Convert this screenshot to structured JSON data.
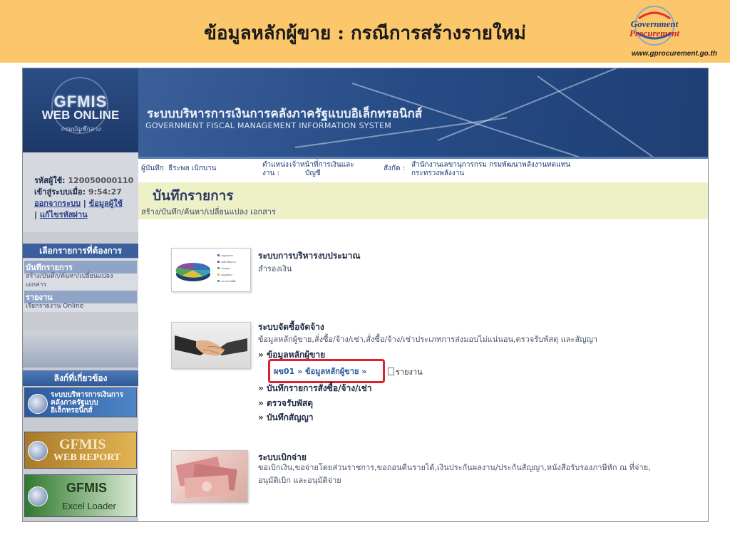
{
  "slide": {
    "title": "ข้อมูลหลักผู้ขาย : กรณีการสร้างรายใหม่",
    "logo_line1": "Government",
    "logo_line2": "Procurement",
    "url": "www.gprocurement.go.th"
  },
  "sidebar": {
    "logo": {
      "line1": "GFMIS",
      "line2": "WEB ONLINE",
      "line3": "กรมบัญชีกลาง"
    },
    "user_label": "รหัสผู้ใช้:",
    "user_id": "120050000110",
    "login_label": "เข้าสู่ระบบเมื่อ:",
    "login_time": "9:54:27",
    "logout_link": "ออกจากระบบ",
    "userinfo_link": "ข้อมูลผู้ใช้",
    "changepw_link": "แก้ไขรหัสผ่าน",
    "menu_header": "เลือกรายการที่ต้องการ",
    "menu_items": [
      {
        "title": "บันทึกรายการ",
        "sub": "สร้าง/บันทึก/ค้นหา/เปลี่ยนแปลง เอกสาร"
      },
      {
        "title": "รายงาน",
        "sub": "เรียกรายงาน Online"
      }
    ],
    "related_header": "ลิงก์ที่เกี่ยวข้อง",
    "banners": [
      {
        "label": "ระบบบริหารการเงินการคลังภาครัฐแบบอิเล็กทรอนิกส์",
        "color": "#3a6fb3"
      },
      {
        "label_line1": "GFMIS",
        "label_line2": "WEB REPORT",
        "color": "#c99a3a"
      },
      {
        "label_line1": "GFMIS",
        "label_line2": "Excel Loader",
        "color": "#3f8f3a"
      }
    ]
  },
  "banner": {
    "system_th": "ระบบบริหารการเงินการคลังภาครัฐแบบอิเล็กทรอนิกส์",
    "system_en": "GOVERNMENT FISCAL MANAGEMENT INFORMATION SYSTEM"
  },
  "info_bar": {
    "recorder_label": "ผู้บันทึก",
    "recorder_value": "ธีระพล เบิกบาน",
    "position_label_1": "ตำแหน่ง",
    "position_label_2": "งาน :",
    "position_value_1": "เจ้าหน้าที่การเงินและ",
    "position_value_2": "บัญชี",
    "dept_label": "สังกัด :",
    "dept_value_1": "สำนักงานเลขานุการกรม กรมพัฒนาพลังงานทดแทน",
    "dept_value_2": "กระทรวงพลังงาน"
  },
  "page": {
    "title": "บันทึกรายการ",
    "subtitle": "สร้าง/บันทึก/ค้นหา/เปลี่ยนแปลง เอกสาร"
  },
  "sections": {
    "budget": {
      "title": "ระบบการบริหารงบประมาณ",
      "desc": "สำรองเงิน",
      "pie": {
        "legend": [
          "งบบุคลากร",
          "งบดำเนินงาน",
          "งบลงทุน",
          "งบอุดหนุน",
          "งบรายจ่ายอื่น"
        ],
        "colors": [
          "#3d6fb5",
          "#8a4aa8",
          "#4fa85a",
          "#d8c03a",
          "#3aa0b8"
        ]
      }
    },
    "procurement": {
      "title": "ระบบจัดซื้อจัดจ้าง",
      "desc": "ข้อมูลหลักผู้ขาย,สั่งซื้อ/จ้าง/เช่า,สั่งซื้อ/จ้าง/เช่าประเภทการส่งมอบไม่แน่นอน,ตรวจรับพัสดุ และสัญญา",
      "links": {
        "vendor_master": "ข้อมูลหลักผู้ขาย",
        "vendor_sub": "ผข01 » ข้อมูลหลักผู้ขาย »",
        "report": "รายงาน",
        "po": "บันทึกรายการสั่งซื้อ/จ้าง/เช่า",
        "inspection": "ตรวจรับพัสดุ",
        "contract": "บันทึกสัญญา"
      }
    },
    "payment": {
      "title": "ระบบเบิกจ่าย",
      "desc_1": "ขอเบิกเงิน,ขอจ่ายโดยส่วนราชการ,ขอถอนคืนรายได้,เงินประกันผลงาน/ประกันสัญญา,หนังสือรับรองภาษีหัก ณ ที่จ่าย,",
      "desc_2": "อนุมัติเบิก และอนุมัติจ่าย"
    }
  }
}
